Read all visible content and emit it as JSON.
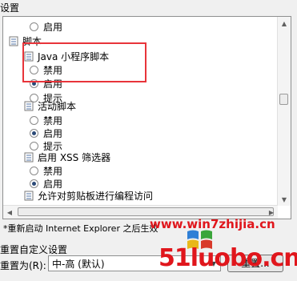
{
  "settings_label": "设置",
  "tree": [
    {
      "kind": "radio",
      "checked": false,
      "label": "启用"
    },
    {
      "kind": "node",
      "label": "脚本"
    },
    {
      "kind": "node",
      "label": "Java 小程序脚本"
    },
    {
      "kind": "radio",
      "checked": false,
      "label": "禁用"
    },
    {
      "kind": "radio",
      "checked": true,
      "label": "启用"
    },
    {
      "kind": "radio",
      "checked": false,
      "label": "提示"
    },
    {
      "kind": "node",
      "label": "活动脚本"
    },
    {
      "kind": "radio",
      "checked": false,
      "label": "禁用"
    },
    {
      "kind": "radio",
      "checked": true,
      "label": "启用"
    },
    {
      "kind": "radio",
      "checked": false,
      "label": "提示"
    },
    {
      "kind": "node",
      "label": "启用 XSS 筛选器"
    },
    {
      "kind": "radio",
      "checked": false,
      "label": "禁用"
    },
    {
      "kind": "radio",
      "checked": true,
      "label": "启用"
    },
    {
      "kind": "node",
      "label": "允许对剪贴板进行编程访问"
    }
  ],
  "note": "*重新启动 Internet Explorer 之后生效",
  "reset": {
    "title": "重置自定义设置",
    "label": "重置为(R):",
    "selected": "中-高 (默认)",
    "button": "重置..."
  },
  "watermark": {
    "site": "www.win7zhijia.cn",
    "big": "51luobo.cn"
  },
  "colors": {
    "highlight": "#e8343a",
    "watermark": "#e0161c"
  }
}
